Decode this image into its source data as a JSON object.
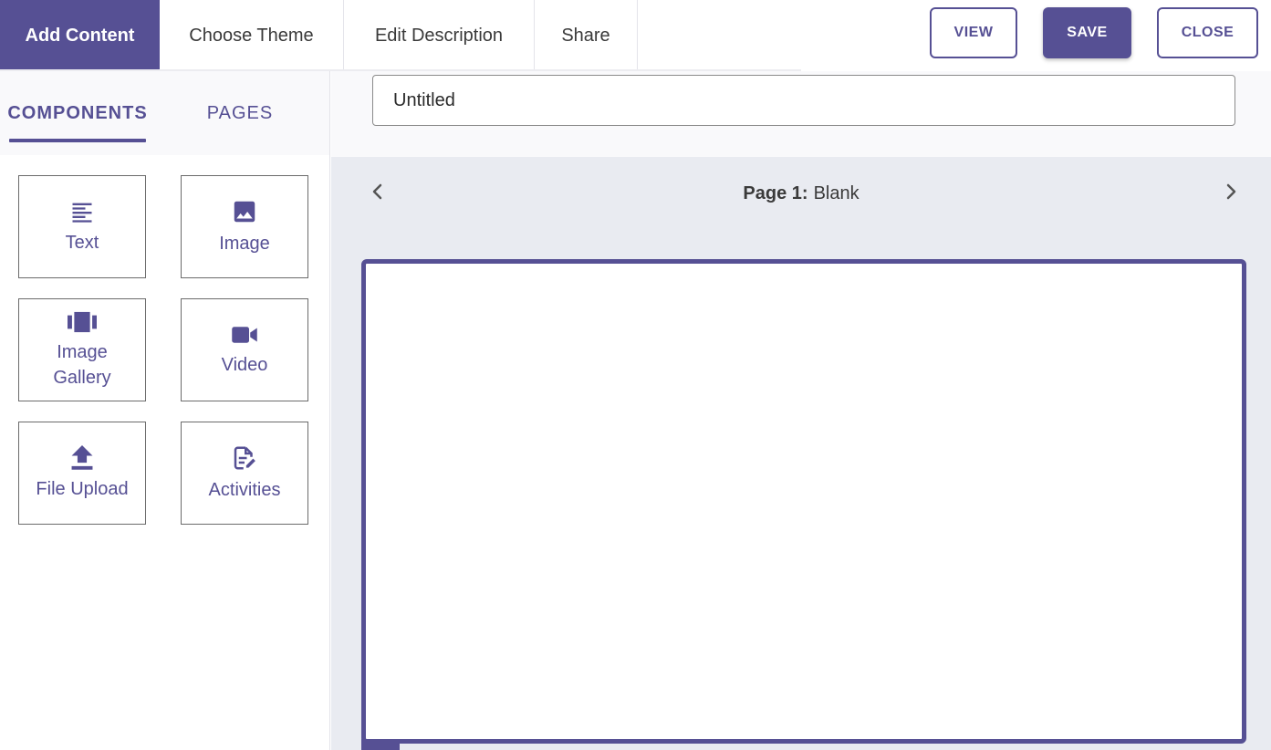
{
  "topbar": {
    "tabs": [
      {
        "label": "Add Content",
        "active": true
      },
      {
        "label": "Choose Theme",
        "active": false
      },
      {
        "label": "Edit Description",
        "active": false
      },
      {
        "label": "Share",
        "active": false
      }
    ],
    "buttons": {
      "view": "VIEW",
      "save": "SAVE",
      "close": "CLOSE"
    }
  },
  "sidebar": {
    "tabs": [
      {
        "label": "COMPONENTS",
        "active": true
      },
      {
        "label": "PAGES",
        "active": false
      }
    ],
    "components": [
      {
        "label": "Text",
        "icon": "text-lines-icon"
      },
      {
        "label": "Image",
        "icon": "image-icon"
      },
      {
        "label": "Image Gallery",
        "icon": "gallery-carousel-icon"
      },
      {
        "label": "Video",
        "icon": "video-camera-icon"
      },
      {
        "label": "File Upload",
        "icon": "upload-icon"
      },
      {
        "label": "Activities",
        "icon": "document-edit-icon"
      }
    ]
  },
  "main": {
    "title_value": "Untitled",
    "page_nav": {
      "page_prefix": "Page 1:",
      "page_name": "Blank"
    }
  },
  "colors": {
    "accent": "#565094",
    "canvas_background": "#e9ebf1",
    "panel_background": "#f9f9fb"
  }
}
